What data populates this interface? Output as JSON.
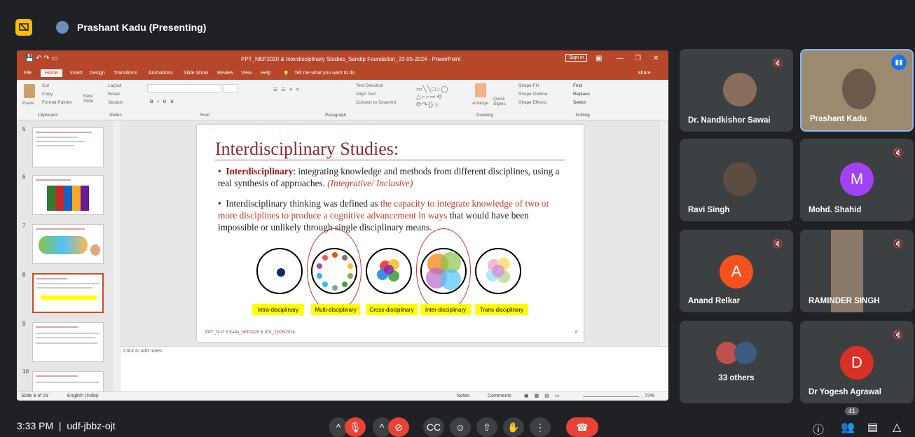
{
  "meeting": {
    "presenter_label": "Prashant Kadu (Presenting)",
    "time": "3:33 PM",
    "code": "udf-jbbz-ojt",
    "people_count": "41"
  },
  "powerpoint": {
    "title": "PPT_NEP2020 & Interdisciplinary Studies_Sandip Foundation_23-05-2024  -  PowerPoint",
    "signin": "Sign in",
    "tabs": [
      "File",
      "Home",
      "Insert",
      "Design",
      "Transitions",
      "Animations",
      "Slide Show",
      "Review",
      "View",
      "Help"
    ],
    "tell_me": "Tell me what you want to do",
    "share": "Share",
    "groups": [
      "Clipboard",
      "Slides",
      "Font",
      "Paragraph",
      "Drawing",
      "Editing"
    ],
    "ribbon_items": {
      "cut": "Cut",
      "copy": "Copy",
      "format_painter": "Format Painter",
      "paste": "Paste",
      "layout": "Layout",
      "reset": "Reset",
      "new_slide": "New Slide",
      "section": "Section",
      "text_direction": "Text Direction",
      "align_text": "Align Text",
      "convert_smartart": "Convert to SmartArt",
      "arrange": "Arrange",
      "quick_styles": "Quick Styles",
      "shape_fill": "Shape Fill",
      "shape_outline": "Shape Outline",
      "shape_effects": "Shape Effects",
      "find": "Find",
      "replace": "Replace",
      "select": "Select"
    },
    "thumb_numbers": [
      "5",
      "6",
      "7",
      "8",
      "9",
      "10"
    ],
    "notes_placeholder": "Click to add notes",
    "status": {
      "slide_of": "Slide 8 of 29",
      "lang": "English (India)",
      "notes": "Notes",
      "comments": "Comments",
      "zoom": "72%"
    }
  },
  "slide": {
    "title": "Interdisciplinary Studies:",
    "b1_bold": "Interdisciplinary",
    "b1_text": ": integrating knowledge and methods from different disciplines, using a real synthesis of approaches. ",
    "b1_italic": "(Integrative/ Inclusive)",
    "b2_a": "Interdisciplinary thinking was defined as ",
    "b2_red": "the capacity to integrate knowledge of two or more disciplines to produce a cognitive advancement in ways",
    "b2_b": " that would have been impossible or unlikely through single  disciplinary means.",
    "labels": [
      "Intra-disciplinary",
      "Multi-disciplinary",
      "Cross-disciplinary",
      "Inter-disciplinary",
      "Trans-disciplinary"
    ],
    "footer": "PPT_Dr P S Kadu_NEP2020 & IDS_23/05/2024",
    "page": "8"
  },
  "participants": [
    {
      "name": "Dr. Nandkishor Sawai"
    },
    {
      "name": "Prashant Kadu"
    },
    {
      "name": "Ravi Singh"
    },
    {
      "name": "Mohd. Shahid",
      "initial": "M",
      "color": "#a142f4"
    },
    {
      "name": "Anand Relkar",
      "initial": "A",
      "color": "#f4511e"
    },
    {
      "name": "RAMINDER SINGH"
    },
    {
      "name": "33 others"
    },
    {
      "name": "Dr Yogesh Agrawal",
      "initial": "D",
      "color": "#d93025"
    }
  ],
  "icons": [
    "present-screen-icon",
    "mic-off-icon",
    "camera-off-icon",
    "captions-icon",
    "emoji-icon",
    "present-icon",
    "raise-hand-icon",
    "more-icon",
    "end-call-icon",
    "info-icon",
    "people-icon",
    "chat-icon",
    "activities-icon"
  ]
}
